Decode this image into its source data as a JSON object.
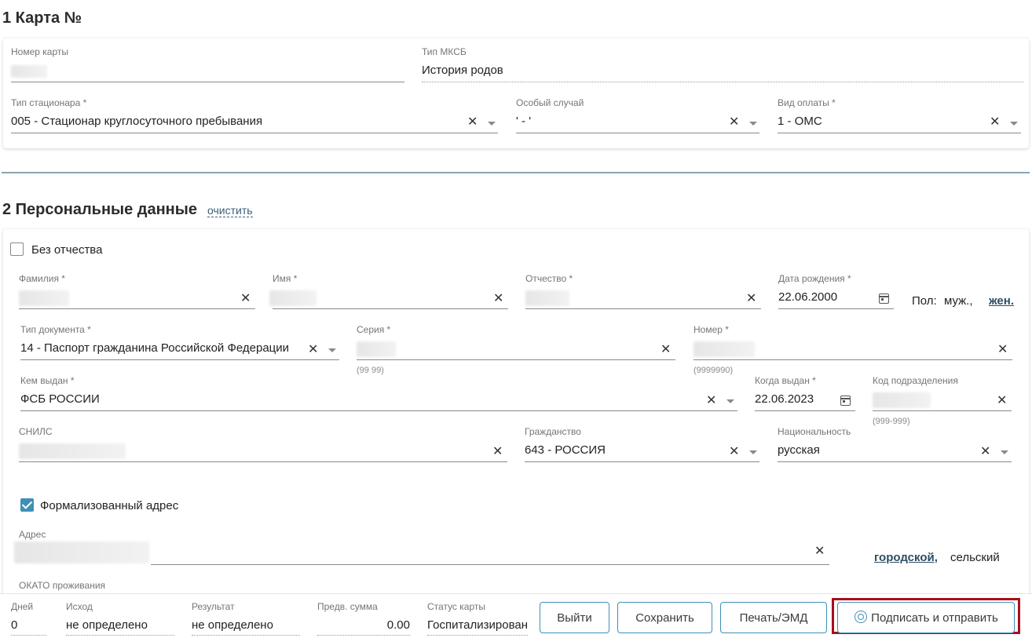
{
  "section1": {
    "title": "1 Карта №",
    "card_number": {
      "label": "Номер карты"
    },
    "mksb_type": {
      "label": "Тип МКСБ",
      "value": "История родов"
    },
    "hospital_type": {
      "label": "Тип стационара *",
      "value": "005 - Стационар круглосуточного пребывания"
    },
    "special_case": {
      "label": "Особый случай",
      "value": "' - '"
    },
    "payment_type": {
      "label": "Вид оплаты *",
      "value": "1 - ОМС"
    }
  },
  "section2": {
    "title": "2 Персональные данные",
    "clear_link": "очистить",
    "no_patronymic": {
      "label": "Без отчества",
      "checked": false
    },
    "last_name": {
      "label": "Фамилия *"
    },
    "first_name": {
      "label": "Имя *"
    },
    "patronymic": {
      "label": "Отчество *"
    },
    "birth_date": {
      "label": "Дата рождения *",
      "value": "22.06.2000"
    },
    "sex": {
      "label": "Пол:",
      "male": "муж.,",
      "female": "жен.",
      "selected": "female"
    },
    "doc_type": {
      "label": "Тип документа *",
      "value": "14 - Паспорт гражданина Российской Федерации"
    },
    "series": {
      "label": "Серия *",
      "hint": "(99 99)"
    },
    "number": {
      "label": "Номер *",
      "hint": "(9999990)"
    },
    "issued_by": {
      "label": "Кем выдан *",
      "value": "ФСБ РОССИИ"
    },
    "issued_date": {
      "label": "Когда выдан *",
      "value": "22.06.2023"
    },
    "division_code": {
      "label": "Код подразделения",
      "hint": "(999-999)"
    },
    "snils": {
      "label": "СНИЛС"
    },
    "citizenship": {
      "label": "Гражданство",
      "value": "643 - РОССИЯ"
    },
    "nationality": {
      "label": "Национальность",
      "value": "русская"
    },
    "formal_address": {
      "label": "Формализованный адрес",
      "checked": true
    },
    "address": {
      "label": "Адрес",
      "urban": "городской,",
      "rural": "сельский",
      "selected": "urban"
    },
    "okato": {
      "label": "ОКАТО проживания"
    }
  },
  "footer": {
    "days": {
      "label": "Дней",
      "value": "0"
    },
    "outcome": {
      "label": "Исход",
      "value": "не определено"
    },
    "result": {
      "label": "Результат",
      "value": "не определено"
    },
    "pre_sum": {
      "label": "Предв. сумма",
      "value": "0.00"
    },
    "card_status": {
      "label": "Статус карты",
      "value": "Госпитализирован"
    },
    "buttons": {
      "exit": "Выйти",
      "save": "Сохранить",
      "print": "Печать/ЭМД",
      "sign": "Подписать и отправить"
    }
  },
  "colors": {
    "accent": "#3f90b6",
    "highlight_frame": "#a80f1c",
    "divider": "#8aa3b0"
  }
}
